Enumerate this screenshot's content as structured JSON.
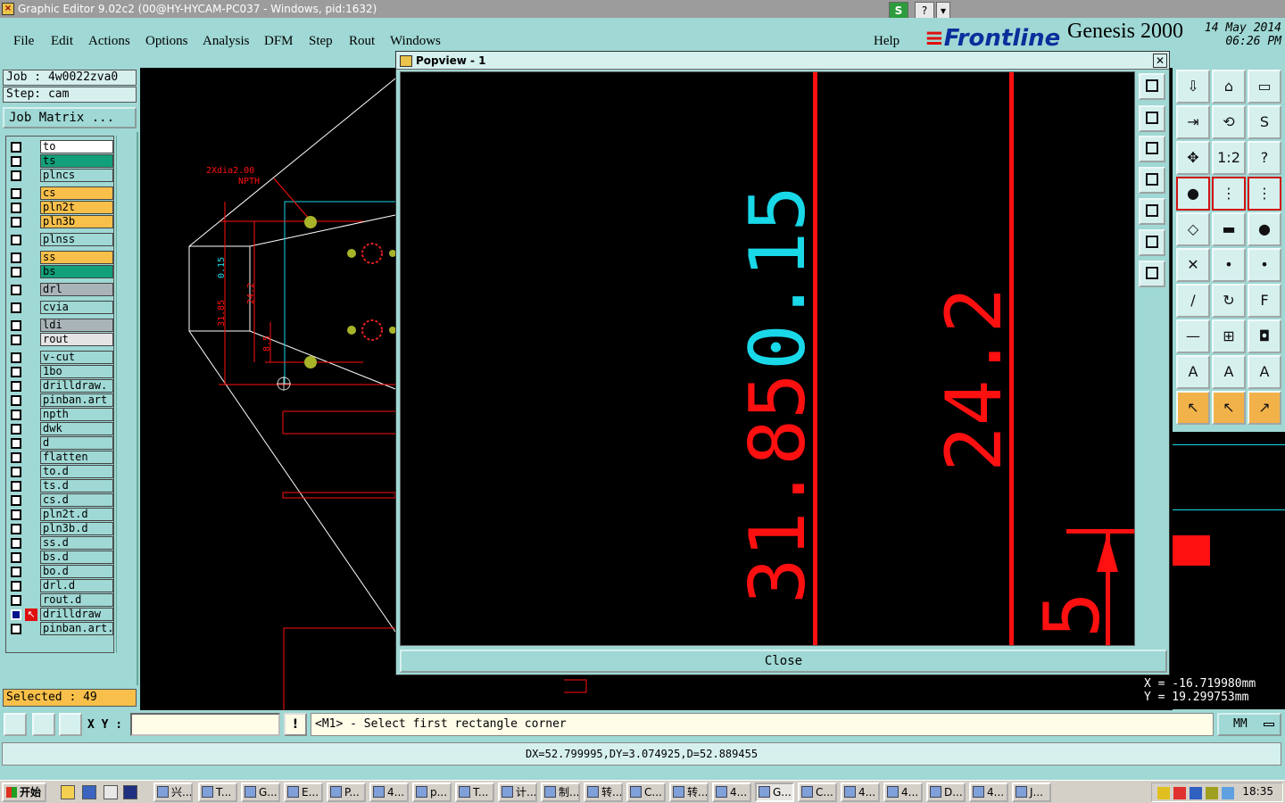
{
  "window": {
    "title": "Graphic Editor 9.02c2 (00@HY-HYCAM-PC037 - Windows, pid:1632)",
    "s_button": "S",
    "help_button": "?",
    "menu_caret": "▾"
  },
  "menu": {
    "items": [
      "File",
      "Edit",
      "Actions",
      "Options",
      "Analysis",
      "DFM",
      "Step",
      "Rout",
      "Windows"
    ],
    "help": "Help"
  },
  "brand": {
    "frontline": "Frontline",
    "product": "Genesis 2000",
    "date": "14 May 2014",
    "time": "06:26 PM"
  },
  "job": {
    "job_line": "Job : 4w0022zva0",
    "step_line": "Step: cam",
    "matrix_button": "Job Matrix ..."
  },
  "layers": [
    {
      "name": "to",
      "color": "#ffffff",
      "checked": false
    },
    {
      "name": "ts",
      "color": "#12a07a",
      "checked": false
    },
    {
      "name": "plncs",
      "color": "#9fd8d4",
      "checked": false
    },
    {
      "name": "cs",
      "color": "#f8c04a",
      "checked": false
    },
    {
      "name": "pln2t",
      "color": "#f8c04a",
      "checked": false
    },
    {
      "name": "pln3b",
      "color": "#f8c04a",
      "checked": false
    },
    {
      "name": "plnss",
      "color": "#9fd8d4",
      "checked": false
    },
    {
      "name": "ss",
      "color": "#f8c04a",
      "checked": false
    },
    {
      "name": "bs",
      "color": "#12a07a",
      "checked": false
    },
    {
      "name": "drl",
      "color": "#a8b4b8",
      "checked": false
    },
    {
      "name": "cvia",
      "color": "#9fd8d4",
      "checked": false
    },
    {
      "name": "ldi",
      "color": "#a8b4b8",
      "checked": false
    },
    {
      "name": "rout",
      "color": "#e4e4e4",
      "checked": false
    },
    {
      "name": "v-cut",
      "color": "#9fd8d4",
      "checked": false
    },
    {
      "name": "1bo",
      "color": "#9fd8d4",
      "checked": false
    },
    {
      "name": "drilldraw.",
      "color": "#9fd8d4",
      "checked": false
    },
    {
      "name": "pinban.art",
      "color": "#9fd8d4",
      "checked": false
    },
    {
      "name": "npth",
      "color": "#9fd8d4",
      "checked": false
    },
    {
      "name": "dwk",
      "color": "#9fd8d4",
      "checked": false
    },
    {
      "name": "d",
      "color": "#9fd8d4",
      "checked": false
    },
    {
      "name": "flatten",
      "color": "#9fd8d4",
      "checked": false
    },
    {
      "name": "to.d",
      "color": "#9fd8d4",
      "checked": false
    },
    {
      "name": "ts.d",
      "color": "#9fd8d4",
      "checked": false
    },
    {
      "name": "cs.d",
      "color": "#9fd8d4",
      "checked": false
    },
    {
      "name": "pln2t.d",
      "color": "#9fd8d4",
      "checked": false
    },
    {
      "name": "pln3b.d",
      "color": "#9fd8d4",
      "checked": false
    },
    {
      "name": "ss.d",
      "color": "#9fd8d4",
      "checked": false
    },
    {
      "name": "bs.d",
      "color": "#9fd8d4",
      "checked": false
    },
    {
      "name": "bo.d",
      "color": "#9fd8d4",
      "checked": false
    },
    {
      "name": "drl.d",
      "color": "#9fd8d4",
      "checked": false
    },
    {
      "name": "rout.d",
      "color": "#9fd8d4",
      "checked": false
    },
    {
      "name": "drilldraw",
      "color": "#9fd8d4",
      "checked": true
    },
    {
      "name": "pinban.art.",
      "color": "#9fd8d4",
      "checked": false
    }
  ],
  "selected": "Selected : 49",
  "canvas": {
    "hole_note": "2Xdia2.00",
    "npth_label": "NPTH",
    "dim_cyan": "0.15",
    "dim_red_1": "31.85",
    "dim_red_2": "24.2",
    "dim_red_3": "8.5"
  },
  "popview": {
    "title": "Popview - 1",
    "close_x": "✕",
    "dim_cyan": "0.15",
    "dim_red_1": "31.85",
    "dim_red_2": "24.2",
    "dim_red_3": "5",
    "close_button": "Close"
  },
  "coords": {
    "x": "X  = -16.719980mm",
    "y": "Y  = 19.299753mm"
  },
  "command": {
    "xy_label": "X Y :",
    "xy_value": "",
    "warn": "!",
    "prompt": "<M1> - Select first rectangle corner",
    "unit": "MM"
  },
  "measure": "DX=52.799995,DY=3.074925,D=52.889455",
  "taskbar": {
    "start": "开始",
    "tasks": [
      "兴...",
      "T...",
      "G...",
      "E...",
      "P...",
      "4...",
      "p...",
      "T...",
      "计...",
      "制...",
      "转...",
      "C...",
      "转...",
      "4...",
      "G...",
      "C...",
      "4...",
      "4...",
      "D...",
      "4...",
      "J..."
    ],
    "clock": "18:35"
  },
  "right_tools": {
    "glyphs": [
      "⇩",
      "⌂",
      "▭",
      "⇥",
      "⟲",
      "S",
      "✥",
      "1:2",
      "?",
      "●",
      "⋮",
      "⋮",
      "◇",
      "▬",
      "●",
      "✕",
      "•",
      "•",
      "∕",
      "↻",
      "F",
      "—",
      "⊞",
      "◘",
      "A",
      "A",
      "A",
      "↖",
      "↖",
      "↗"
    ]
  },
  "colors": {
    "panel": "#9fd8d4",
    "canvas_bg": "#000000",
    "drawing_red": "#ff1010",
    "drawing_cyan": "#19d8e8",
    "selected_bg": "#f8c04a"
  }
}
